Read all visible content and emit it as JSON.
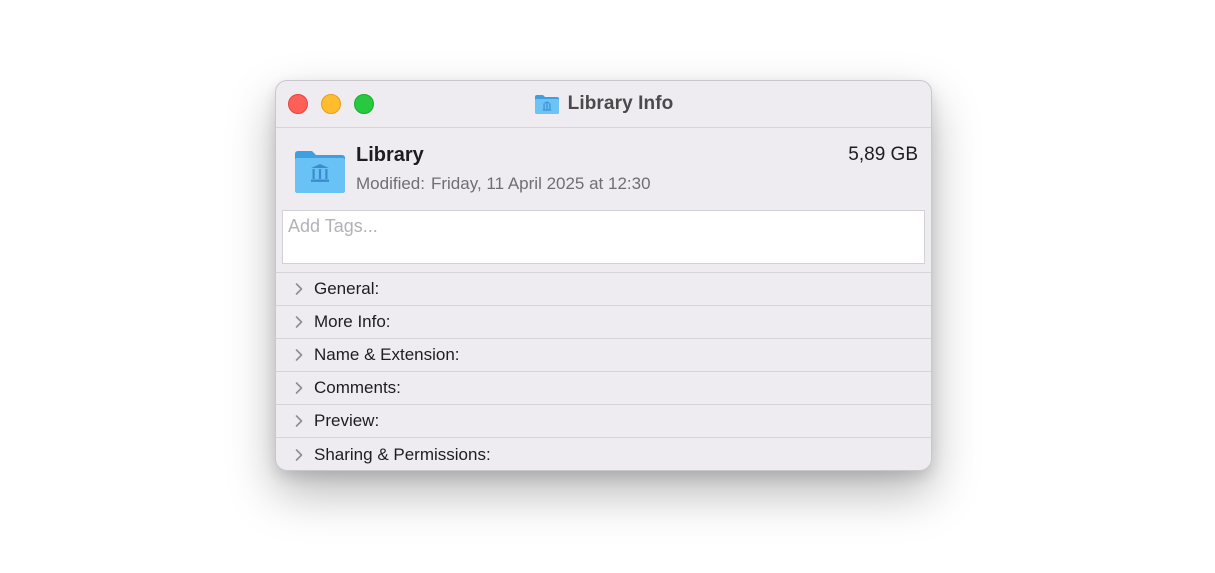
{
  "window": {
    "title": "Library Info",
    "title_icon": "library-folder-icon",
    "controls": [
      "close-button",
      "minimize-button",
      "zoom-button"
    ]
  },
  "file": {
    "name": "Library",
    "size": "5,89 GB",
    "modified_label": "Modified:",
    "modified_value": "Friday, 11 April 2025 at 12:30",
    "icon": "library-folder-icon"
  },
  "tags": {
    "placeholder": "Add Tags..."
  },
  "sections": [
    {
      "label": "General:"
    },
    {
      "label": "More Info:"
    },
    {
      "label": "Name & Extension:"
    },
    {
      "label": "Comments:"
    },
    {
      "label": "Preview:"
    },
    {
      "label": "Sharing & Permissions:"
    }
  ],
  "colors": {
    "close": "#fe5f57",
    "minimize": "#febc2e",
    "zoom": "#28c840",
    "folder": "#5ab8f1"
  }
}
